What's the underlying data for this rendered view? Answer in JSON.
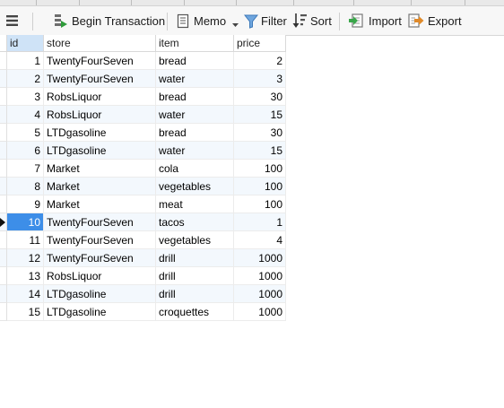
{
  "toolbar": {
    "menu_icon": "hamburger-menu-icon",
    "begin_transaction": "Begin Transaction",
    "memo": "Memo",
    "filter": "Filter",
    "sort": "Sort",
    "import": "Import",
    "export": "Export"
  },
  "columns": [
    "id",
    "store",
    "item",
    "price"
  ],
  "rows": [
    {
      "id": "1",
      "store": "TwentyFourSeven",
      "item": "bread",
      "price": "2"
    },
    {
      "id": "2",
      "store": "TwentyFourSeven",
      "item": "water",
      "price": "3"
    },
    {
      "id": "3",
      "store": "RobsLiquor",
      "item": "bread",
      "price": "30"
    },
    {
      "id": "4",
      "store": "RobsLiquor",
      "item": "water",
      "price": "15"
    },
    {
      "id": "5",
      "store": "LTDgasoline",
      "item": "bread",
      "price": "30"
    },
    {
      "id": "6",
      "store": "LTDgasoline",
      "item": "water",
      "price": "15"
    },
    {
      "id": "7",
      "store": "Market",
      "item": "cola",
      "price": "100"
    },
    {
      "id": "8",
      "store": "Market",
      "item": "vegetables",
      "price": "100"
    },
    {
      "id": "9",
      "store": "Market",
      "item": "meat",
      "price": "100"
    },
    {
      "id": "10",
      "store": "TwentyFourSeven",
      "item": "tacos",
      "price": "1"
    },
    {
      "id": "11",
      "store": "TwentyFourSeven",
      "item": "vegetables",
      "price": "4"
    },
    {
      "id": "12",
      "store": "TwentyFourSeven",
      "item": "drill",
      "price": "1000"
    },
    {
      "id": "13",
      "store": "RobsLiquor",
      "item": "drill",
      "price": "1000"
    },
    {
      "id": "14",
      "store": "LTDgasoline",
      "item": "drill",
      "price": "1000"
    },
    {
      "id": "15",
      "store": "LTDgasoline",
      "item": "croquettes",
      "price": "1000"
    }
  ],
  "selected_row_id": "10",
  "colors": {
    "selected_cell": "#3d8ee8",
    "header_selected": "#cfe3f7",
    "alt_row": "#f3f8fd"
  }
}
